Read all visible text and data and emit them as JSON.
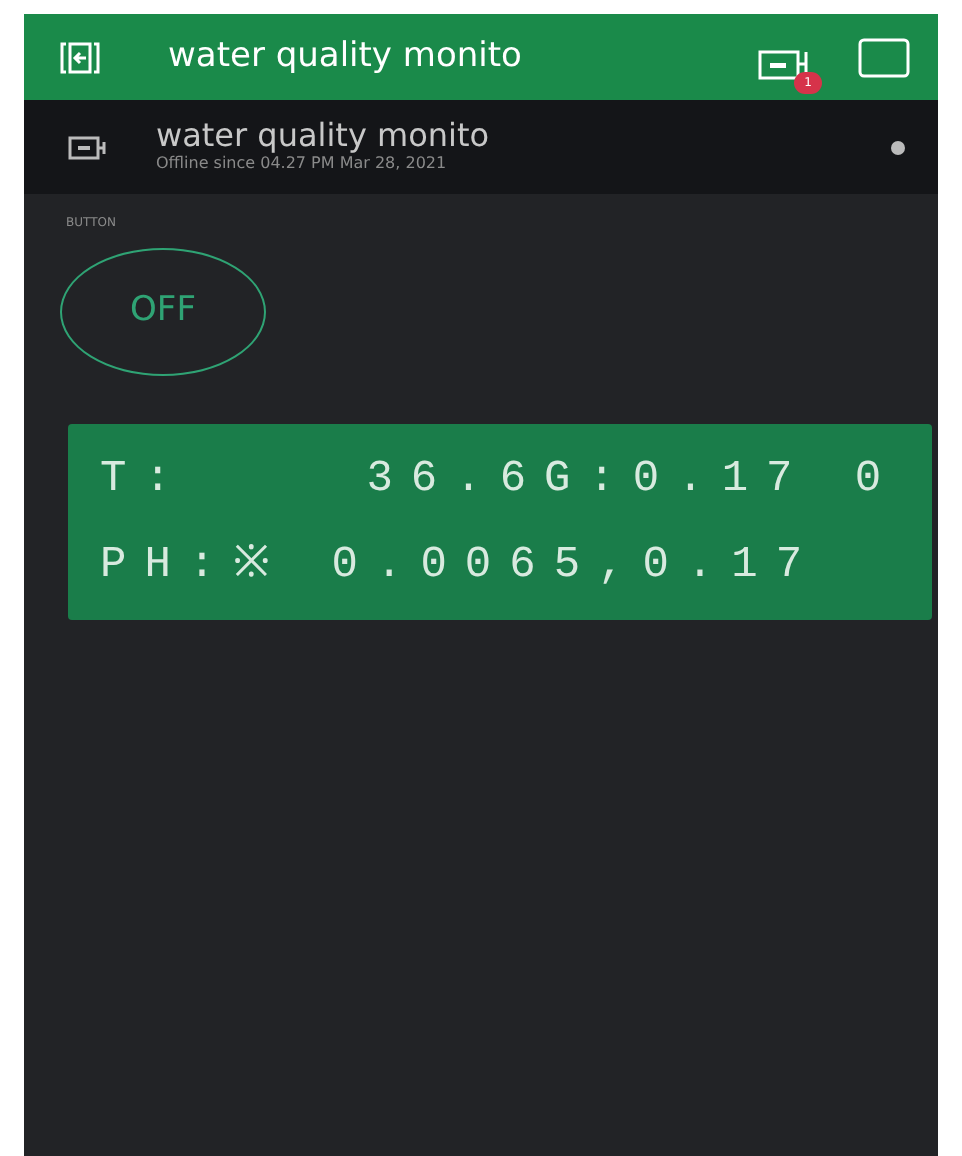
{
  "header": {
    "title": "water quality monito",
    "notification_count": "1"
  },
  "device": {
    "name": "water quality monito",
    "status": "Offline since 04.27 PM Mar 28, 2021",
    "online": false
  },
  "button_widget": {
    "label": "BUTTON",
    "text": "OFF",
    "on": false
  },
  "lcd": {
    "lines": [
      "T:    36.6G:0.17 0",
      "PH:※ 0.0065,0.17"
    ]
  }
}
